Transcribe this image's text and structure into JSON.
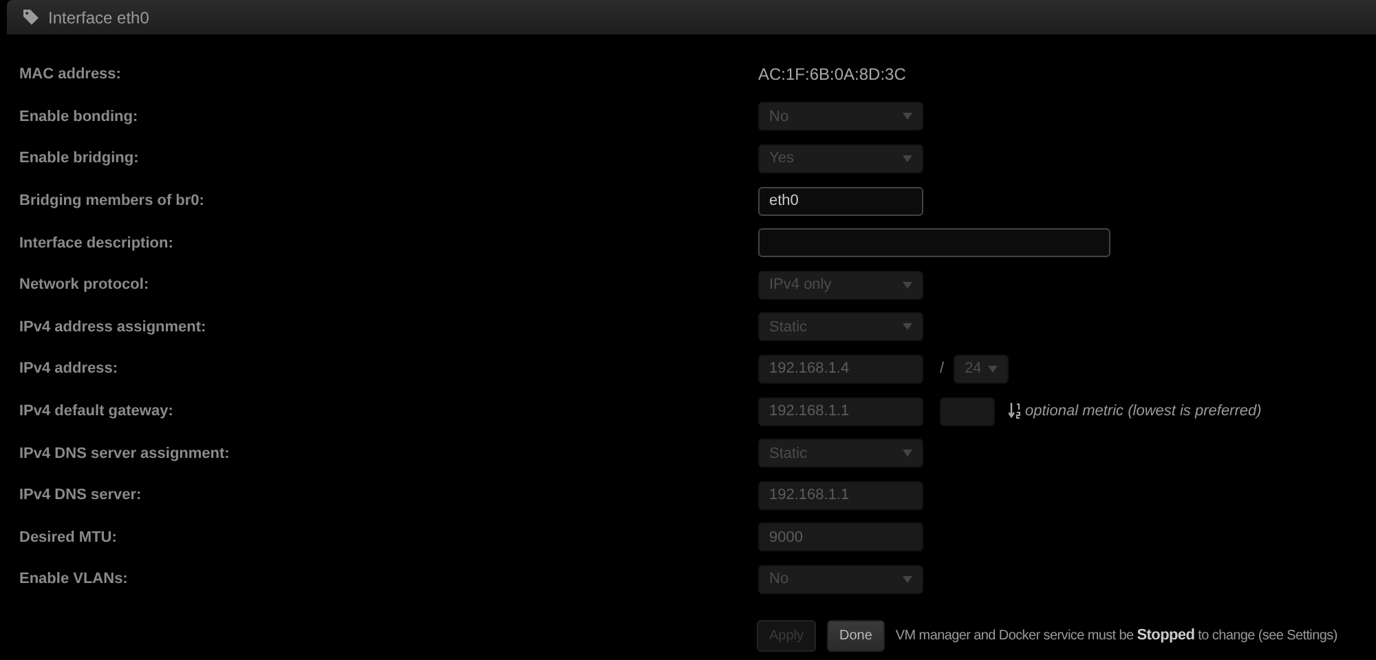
{
  "panel": {
    "title": "Interface eth0"
  },
  "rows": [
    {
      "label": "MAC address:",
      "kind": "text",
      "value": "AC:1F:6B:0A:8D:3C"
    },
    {
      "label": "Enable bonding:",
      "kind": "select",
      "value": "No",
      "disabled": true
    },
    {
      "label": "Enable bridging:",
      "kind": "select",
      "value": "Yes",
      "disabled": true
    },
    {
      "label": "Bridging members of br0:",
      "kind": "input",
      "value": "eth0",
      "disabled": false
    },
    {
      "label": "Interface description:",
      "kind": "wide_input",
      "disabled": false
    },
    {
      "label": "Network protocol:",
      "kind": "select",
      "value": "IPv4 only",
      "disabled": true
    },
    {
      "label": "IPv4 address assignment:",
      "kind": "select",
      "value": "Static",
      "disabled": true
    },
    {
      "label": "IPv4 address:",
      "kind": "address",
      "value": "192.168.1.4",
      "disabled": true,
      "separator": "/",
      "prefix": "24"
    },
    {
      "label": "IPv4 default gateway:",
      "kind": "gateway",
      "value": "192.168.1.1",
      "disabled": true,
      "metric_hint": "optional metric (lowest is preferred)"
    },
    {
      "label": "IPv4 DNS server assignment:",
      "kind": "select",
      "value": "Static",
      "disabled": true
    },
    {
      "label": "IPv4 DNS server:",
      "kind": "input",
      "value": "192.168.1.1",
      "disabled": true
    },
    {
      "label": "Desired MTU:",
      "kind": "input",
      "value": "9000",
      "disabled": true
    },
    {
      "label": "Enable VLANs:",
      "kind": "select",
      "value": "No",
      "disabled": true
    }
  ],
  "buttons": [
    {
      "label": "Apply",
      "disabled": true
    },
    {
      "label": "Done",
      "disabled": false
    }
  ],
  "note": "VM manager and Docker service must be **Stopped** to change (see Settings)"
}
